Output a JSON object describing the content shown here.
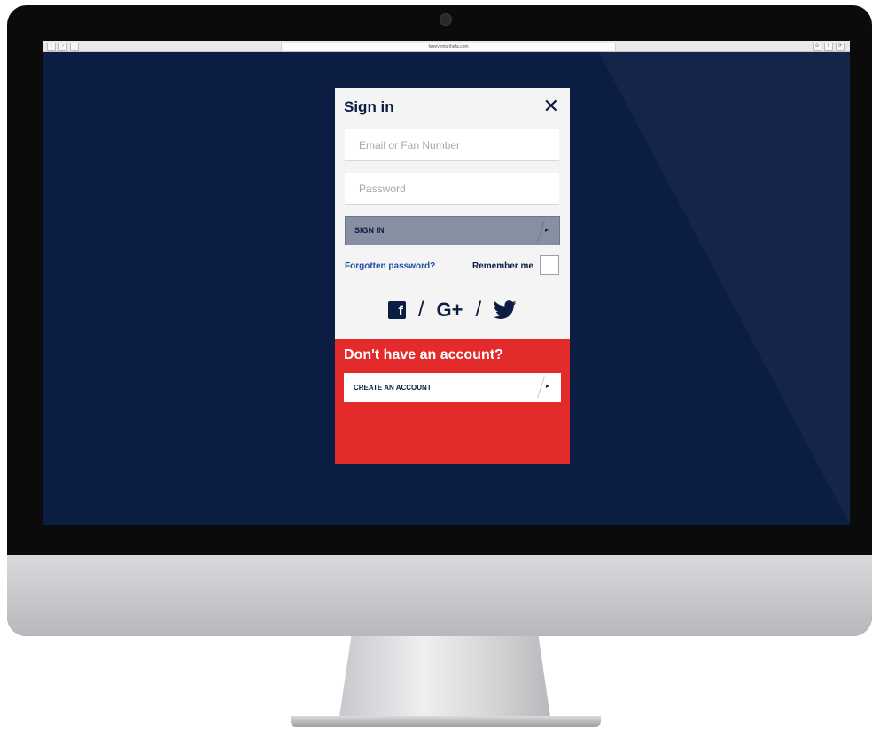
{
  "browser": {
    "url": "fanevents.thefa.com",
    "nav_back": "‹",
    "nav_forward": "›",
    "sidebar_icon": "sidebar-icon",
    "reload_icon": "⟳",
    "share_icon": "⇪",
    "download_icon": "⊙"
  },
  "modal": {
    "title": "Sign in",
    "close_icon": "✕",
    "email_placeholder": "Email or Fan Number",
    "password_placeholder": "Password",
    "signin_label": "SIGN IN",
    "arrow_icon": "▸",
    "forgot_label": "Forgotten password?",
    "remember_label": "Remember me",
    "social": {
      "facebook_icon": "f",
      "gplus_label": "G+",
      "separator": "/"
    },
    "no_account_title": "Don't have an account?",
    "create_label": "CREATE AN ACCOUNT"
  },
  "colors": {
    "screen_bg": "#0c1d43",
    "navy": "#0c1d43",
    "red": "#e22b2a",
    "link": "#1d4fa3",
    "signin_btn": "#8790a3"
  }
}
